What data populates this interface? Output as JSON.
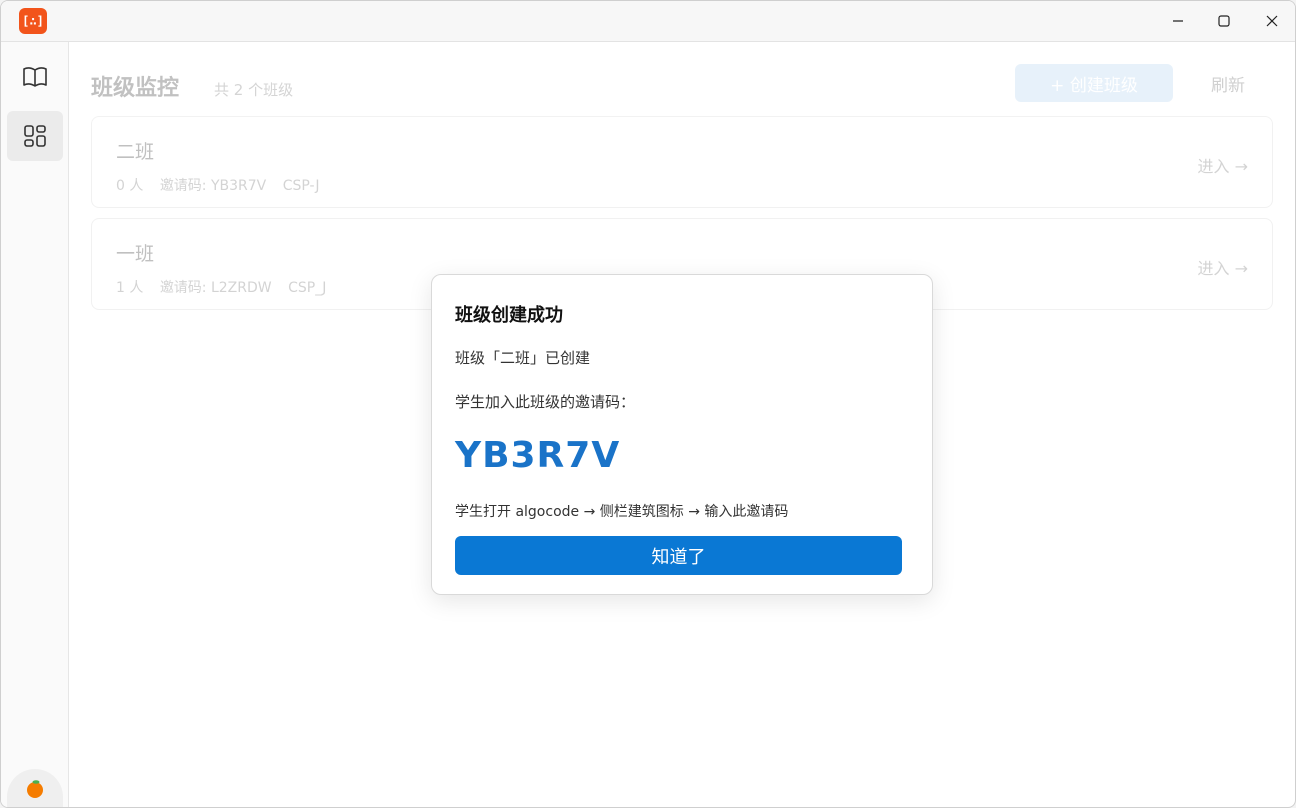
{
  "window": {
    "logo_text": "[∴]"
  },
  "sidebar": {
    "items": [
      {
        "name": "book",
        "icon": "book-icon",
        "active": false
      },
      {
        "name": "grid",
        "icon": "grid-icon",
        "active": true
      }
    ],
    "avatar_icon": "orange-icon"
  },
  "header": {
    "title": "班级监控",
    "count": "共 2 个班级",
    "create_label": "+ 创建班级",
    "refresh_label": "刷新"
  },
  "classes": [
    {
      "name": "二班",
      "members": "0 人",
      "invite": "邀请码: YB3R7V",
      "tag": "CSP-J",
      "enter_label": "进入 →"
    },
    {
      "name": "一班",
      "members": "1 人",
      "invite": "邀请码: L2ZRDW",
      "tag": "CSP_J",
      "enter_label": "进入 →"
    }
  ],
  "modal": {
    "title": "班级创建成功",
    "message": "班级「二班」已创建",
    "code_label": "学生加入此班级的邀请码：",
    "code": "YB3R7V",
    "hint": "学生打开 algocode → 侧栏建筑图标 → 输入此邀请码",
    "ok_label": "知道了"
  },
  "colors": {
    "accent": "#0a78d4",
    "code": "#1a73c8",
    "logo": "#f2541b"
  }
}
